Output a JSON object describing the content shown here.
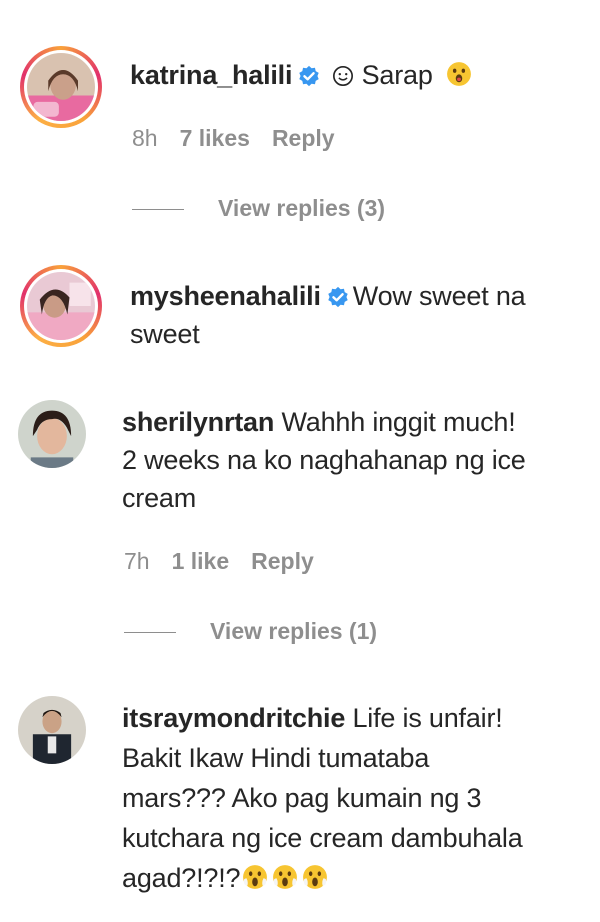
{
  "comments": [
    {
      "username": "katrina_halili",
      "verified": true,
      "text_pre_icon": "",
      "inline_icon": "smiling-face-icon",
      "text": "Sarap",
      "trailing_emoji": "astonished-face-icon",
      "meta": {
        "time": "8h",
        "likes": "7 likes",
        "reply": "Reply"
      },
      "view_replies": "View replies (3)"
    },
    {
      "username": "mysheenahalili",
      "verified": true,
      "text_line1": "Wow sweet na",
      "text_line2": "sweet"
    },
    {
      "username": "sherilynrtan",
      "verified": false,
      "text_line1": "Wahhh inggit much!",
      "text_line2": "2 weeks na ko naghahanap ng ice",
      "text_line3": "cream",
      "meta": {
        "time": "7h",
        "likes": "1 like",
        "reply": "Reply"
      },
      "view_replies": "View replies (1)"
    },
    {
      "username": "itsraymondritchie",
      "verified": false,
      "text_line1": "Life is unfair!",
      "text_line2": "Bakit Ikaw Hindi tumataba",
      "text_line3": "mars??? Ako pag kumain ng 3",
      "text_line4": "kutchara ng ice cream dambuhala",
      "text_line5": "agad?!?!?",
      "trailing_emojis": [
        "face-screaming-icon",
        "face-screaming-icon",
        "face-screaming-icon"
      ]
    }
  ],
  "colors": {
    "verified": "#3897f0",
    "muted": "#8e8e8e",
    "text": "#262626"
  }
}
